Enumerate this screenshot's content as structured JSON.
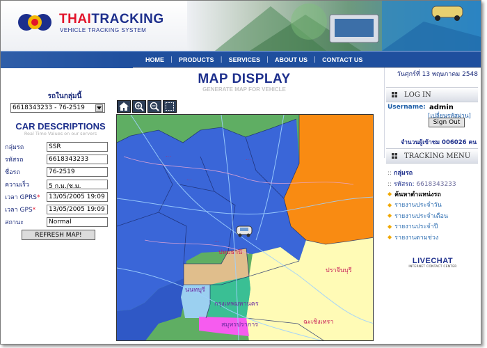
{
  "brand": {
    "name_red": "THAI",
    "name_blue": "TRACKING",
    "tagline": "VEHICLE TRACKING SYSTEM"
  },
  "nav": {
    "items": [
      "HOME",
      "PRODUCTS",
      "SERVICES",
      "ABOUT US",
      "CONTACT US"
    ]
  },
  "left": {
    "group_label": "รถในกลุ่มนี้",
    "car_select": "6618343233 - 76-2519",
    "desc_title": "CAR DESCRIPTIONS",
    "desc_sub": "Real Time Values on our servers",
    "fields": [
      {
        "label": "กลุ่มรถ",
        "value": "SSR",
        "star": ""
      },
      {
        "label": "รหัสรถ",
        "value": "6618343233",
        "star": ""
      },
      {
        "label": "ชื่อรถ",
        "value": "76-2519",
        "star": ""
      },
      {
        "label": "ความเร็ว",
        "value": "5 ก.ม./ช.ม.",
        "star": ""
      },
      {
        "label": "เวลา GPRS",
        "value": "13/05/2005 19:09",
        "star": "*"
      },
      {
        "label": "เวลา GPS",
        "value": "13/05/2005 19:09",
        "star": "*"
      },
      {
        "label": "สถานะ",
        "value": "Normal",
        "star": ""
      }
    ],
    "refresh_label": "REFRESH MAP!"
  },
  "center": {
    "title": "MAP DISPLAY",
    "subtitle": "GENERATE MAP FOR VEHICLE",
    "tools": [
      "home-icon",
      "zoom-in-icon",
      "zoom-out-icon",
      "full-extent-icon"
    ],
    "map_labels": [
      "ปทุมธานี",
      "นนทบุรี",
      "กรุงเทพมหานคร",
      "สมุทรปราการ",
      "ปราจีนบุรี",
      "ฉะเชิงเทรา"
    ]
  },
  "right": {
    "date": "วันศุกร์ที่ 13 พฤษภาคม 2548",
    "login_title": "LOG IN",
    "username_label": "Username:",
    "username_value": "admin",
    "change_password": "[เปลี่ยนรหัสผ่าน]",
    "signout_label": "Sign Out",
    "visitors": "จำนวนผู้เข้าชม 006026 คน",
    "tracking_title": "TRACKING MENU",
    "track_group_prefix": ":: ",
    "track_group": "กลุ่มรถ",
    "track_code_prefix": ":: ",
    "track_code_label": "รหัสรถ: ",
    "track_code_value": "6618343233",
    "menu": [
      "ค้นหาตำแหน่งรถ",
      "รายงานประจำวัน",
      "รายงานประจำเดือน",
      "รายงานประจำปี",
      "รายงานตามช่วง"
    ],
    "livechat_title": "LIVECHAT",
    "livechat_sub": "INTERNET CONTACT CENTER"
  },
  "colors": {
    "brand_blue": "#1d2f8c",
    "brand_red": "#e2132a",
    "nav": "#1f4f9e",
    "link": "#2f6fb2",
    "bullet": "#f0a800"
  }
}
